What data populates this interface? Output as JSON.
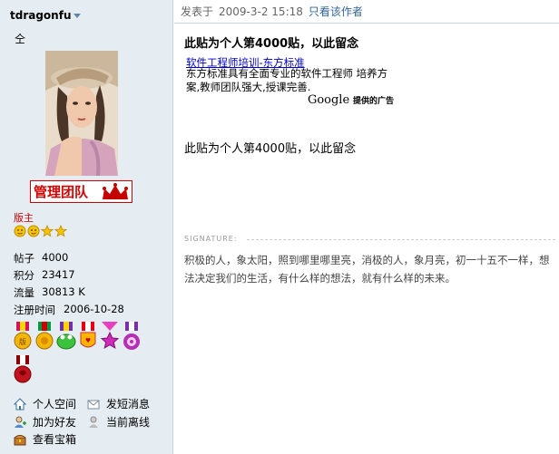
{
  "user": {
    "username": "tdragonfu",
    "custom_title": "仝",
    "team_badge": "管理团队",
    "role": "版主",
    "stars": 3,
    "stats": [
      {
        "label": "帖子",
        "value": "4000"
      },
      {
        "label": "积分",
        "value": "23417"
      },
      {
        "label": "流量",
        "value": "30813 K"
      },
      {
        "label": "注册时间",
        "value": "2006-10-28"
      }
    ],
    "medals": [
      "medal-icon",
      "medal-icon",
      "frog-medal-icon",
      "badge-medal-icon",
      "star-medal-icon",
      "flower-medal-icon",
      "ribbon-medal-icon"
    ],
    "actions": [
      {
        "label": "个人空间",
        "icon": "home-icon"
      },
      {
        "label": "发短消息",
        "icon": "mail-icon"
      },
      {
        "label": "加为好友",
        "icon": "add-friend-icon"
      },
      {
        "label": "当前离线",
        "icon": "offline-icon"
      },
      {
        "label": "查看宝箱",
        "icon": "treasure-box-icon"
      }
    ]
  },
  "post": {
    "meta_prefix": "发表于",
    "date": "2009-3-2 15:18",
    "author_only": "只看该作者",
    "title": "此贴为个人第4000贴，以此留念",
    "body": "此贴为个人第4000贴，以此留念",
    "ad": {
      "link": "软件工程师培训-东方标准",
      "text": "东方标准具有全面专业的软件工程师 培养方案,教师团队强大,授课完善.",
      "brand": "Google",
      "brand_suffix": "提供的广告"
    },
    "signature_label": "SIGNATURE:",
    "signature": "积极的人，象太阳，照到哪里哪里亮，消极的人，象月亮，初一十五不一样，想法决定我们的生活，有什么样的想法，就有什么样的未来。"
  },
  "colors": {
    "left_bg": "#e5edf2",
    "role_red": "#cc0000",
    "link_blue": "#336699"
  }
}
